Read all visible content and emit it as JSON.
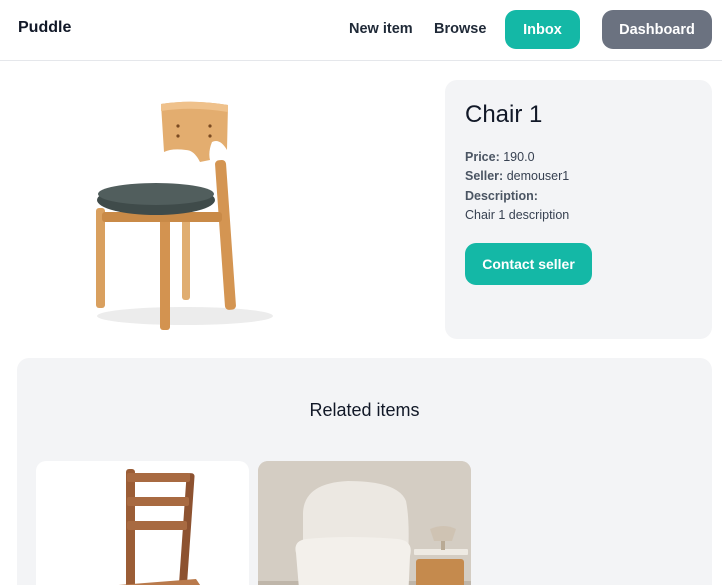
{
  "nav": {
    "brand": "Puddle",
    "new_item": "New item",
    "browse": "Browse",
    "inbox": "Inbox",
    "dashboard": "Dashboard"
  },
  "item": {
    "title": "Chair 1",
    "price_label": "Price:",
    "price": "190.0",
    "seller_label": "Seller:",
    "seller": "demouser1",
    "description_label": "Description:",
    "description": "Chair 1 description",
    "contact_button": "Contact seller"
  },
  "related": {
    "title": "Related items"
  },
  "colors": {
    "accent": "#14b8a6",
    "secondary": "#6b7280",
    "panel": "#f3f4f6"
  }
}
